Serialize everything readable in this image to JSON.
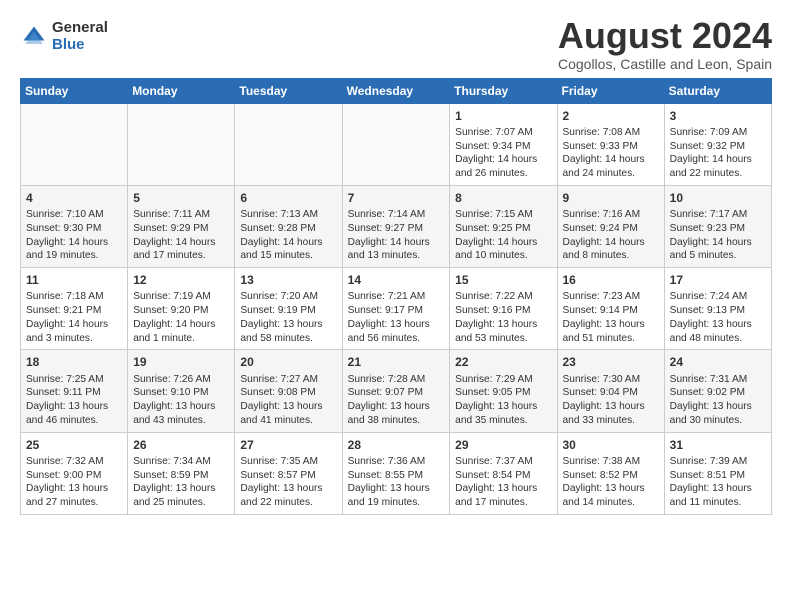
{
  "logo": {
    "general": "General",
    "blue": "Blue"
  },
  "header": {
    "month_year": "August 2024",
    "location": "Cogollos, Castille and Leon, Spain"
  },
  "weekdays": [
    "Sunday",
    "Monday",
    "Tuesday",
    "Wednesday",
    "Thursday",
    "Friday",
    "Saturday"
  ],
  "weeks": [
    [
      {
        "day": "",
        "content": ""
      },
      {
        "day": "",
        "content": ""
      },
      {
        "day": "",
        "content": ""
      },
      {
        "day": "",
        "content": ""
      },
      {
        "day": "1",
        "content": "Sunrise: 7:07 AM\nSunset: 9:34 PM\nDaylight: 14 hours and 26 minutes."
      },
      {
        "day": "2",
        "content": "Sunrise: 7:08 AM\nSunset: 9:33 PM\nDaylight: 14 hours and 24 minutes."
      },
      {
        "day": "3",
        "content": "Sunrise: 7:09 AM\nSunset: 9:32 PM\nDaylight: 14 hours and 22 minutes."
      }
    ],
    [
      {
        "day": "4",
        "content": "Sunrise: 7:10 AM\nSunset: 9:30 PM\nDaylight: 14 hours and 19 minutes."
      },
      {
        "day": "5",
        "content": "Sunrise: 7:11 AM\nSunset: 9:29 PM\nDaylight: 14 hours and 17 minutes."
      },
      {
        "day": "6",
        "content": "Sunrise: 7:13 AM\nSunset: 9:28 PM\nDaylight: 14 hours and 15 minutes."
      },
      {
        "day": "7",
        "content": "Sunrise: 7:14 AM\nSunset: 9:27 PM\nDaylight: 14 hours and 13 minutes."
      },
      {
        "day": "8",
        "content": "Sunrise: 7:15 AM\nSunset: 9:25 PM\nDaylight: 14 hours and 10 minutes."
      },
      {
        "day": "9",
        "content": "Sunrise: 7:16 AM\nSunset: 9:24 PM\nDaylight: 14 hours and 8 minutes."
      },
      {
        "day": "10",
        "content": "Sunrise: 7:17 AM\nSunset: 9:23 PM\nDaylight: 14 hours and 5 minutes."
      }
    ],
    [
      {
        "day": "11",
        "content": "Sunrise: 7:18 AM\nSunset: 9:21 PM\nDaylight: 14 hours and 3 minutes."
      },
      {
        "day": "12",
        "content": "Sunrise: 7:19 AM\nSunset: 9:20 PM\nDaylight: 14 hours and 1 minute."
      },
      {
        "day": "13",
        "content": "Sunrise: 7:20 AM\nSunset: 9:19 PM\nDaylight: 13 hours and 58 minutes."
      },
      {
        "day": "14",
        "content": "Sunrise: 7:21 AM\nSunset: 9:17 PM\nDaylight: 13 hours and 56 minutes."
      },
      {
        "day": "15",
        "content": "Sunrise: 7:22 AM\nSunset: 9:16 PM\nDaylight: 13 hours and 53 minutes."
      },
      {
        "day": "16",
        "content": "Sunrise: 7:23 AM\nSunset: 9:14 PM\nDaylight: 13 hours and 51 minutes."
      },
      {
        "day": "17",
        "content": "Sunrise: 7:24 AM\nSunset: 9:13 PM\nDaylight: 13 hours and 48 minutes."
      }
    ],
    [
      {
        "day": "18",
        "content": "Sunrise: 7:25 AM\nSunset: 9:11 PM\nDaylight: 13 hours and 46 minutes."
      },
      {
        "day": "19",
        "content": "Sunrise: 7:26 AM\nSunset: 9:10 PM\nDaylight: 13 hours and 43 minutes."
      },
      {
        "day": "20",
        "content": "Sunrise: 7:27 AM\nSunset: 9:08 PM\nDaylight: 13 hours and 41 minutes."
      },
      {
        "day": "21",
        "content": "Sunrise: 7:28 AM\nSunset: 9:07 PM\nDaylight: 13 hours and 38 minutes."
      },
      {
        "day": "22",
        "content": "Sunrise: 7:29 AM\nSunset: 9:05 PM\nDaylight: 13 hours and 35 minutes."
      },
      {
        "day": "23",
        "content": "Sunrise: 7:30 AM\nSunset: 9:04 PM\nDaylight: 13 hours and 33 minutes."
      },
      {
        "day": "24",
        "content": "Sunrise: 7:31 AM\nSunset: 9:02 PM\nDaylight: 13 hours and 30 minutes."
      }
    ],
    [
      {
        "day": "25",
        "content": "Sunrise: 7:32 AM\nSunset: 9:00 PM\nDaylight: 13 hours and 27 minutes."
      },
      {
        "day": "26",
        "content": "Sunrise: 7:34 AM\nSunset: 8:59 PM\nDaylight: 13 hours and 25 minutes."
      },
      {
        "day": "27",
        "content": "Sunrise: 7:35 AM\nSunset: 8:57 PM\nDaylight: 13 hours and 22 minutes."
      },
      {
        "day": "28",
        "content": "Sunrise: 7:36 AM\nSunset: 8:55 PM\nDaylight: 13 hours and 19 minutes."
      },
      {
        "day": "29",
        "content": "Sunrise: 7:37 AM\nSunset: 8:54 PM\nDaylight: 13 hours and 17 minutes."
      },
      {
        "day": "30",
        "content": "Sunrise: 7:38 AM\nSunset: 8:52 PM\nDaylight: 13 hours and 14 minutes."
      },
      {
        "day": "31",
        "content": "Sunrise: 7:39 AM\nSunset: 8:51 PM\nDaylight: 13 hours and 11 minutes."
      }
    ]
  ]
}
